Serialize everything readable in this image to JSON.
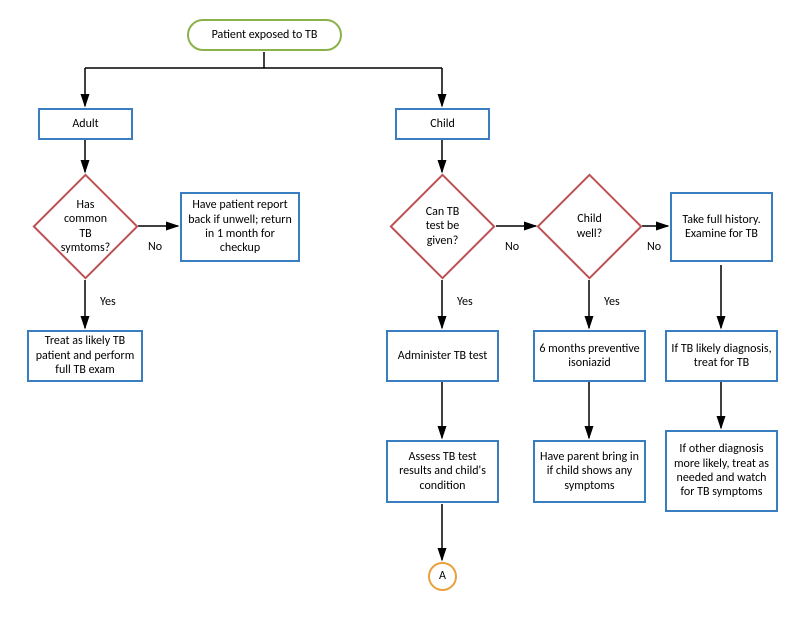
{
  "chart_data": {
    "type": "flowchart",
    "nodes": [
      {
        "id": "start",
        "type": "terminator",
        "text": "Patient exposed to TB"
      },
      {
        "id": "adult",
        "type": "process",
        "text": "Adult"
      },
      {
        "id": "child",
        "type": "process",
        "text": "Child"
      },
      {
        "id": "d_symptoms",
        "type": "decision",
        "text": "Has common TB symtoms?"
      },
      {
        "id": "report_back",
        "type": "process",
        "text": "Have patient report back if unwell; return in 1 month for checkup"
      },
      {
        "id": "full_exam",
        "type": "process",
        "text": "Treat as likely TB patient and perform full TB exam"
      },
      {
        "id": "d_tb_test",
        "type": "decision",
        "text": "Can TB test be given?"
      },
      {
        "id": "d_child_well",
        "type": "decision",
        "text": "Child well?"
      },
      {
        "id": "take_history",
        "type": "process",
        "text": "Take full history. Examine for TB"
      },
      {
        "id": "admin_test",
        "type": "process",
        "text": "Administer TB test"
      },
      {
        "id": "isoniazid",
        "type": "process",
        "text": "6 months preventive isoniazid"
      },
      {
        "id": "treat_tb",
        "type": "process",
        "text": "If TB likely diagnosis, treat for TB"
      },
      {
        "id": "assess_results",
        "type": "process",
        "text": "Assess TB test results and child's condition"
      },
      {
        "id": "parent_bring",
        "type": "process",
        "text": "Have parent bring in if child shows any symptoms"
      },
      {
        "id": "other_diag",
        "type": "process",
        "text": "If other diagnosis more likely, treat as needed and watch for TB symptoms"
      },
      {
        "id": "conn_a",
        "type": "connector",
        "text": "A"
      }
    ],
    "edges": [
      {
        "from": "start",
        "to": "adult"
      },
      {
        "from": "start",
        "to": "child"
      },
      {
        "from": "adult",
        "to": "d_symptoms"
      },
      {
        "from": "d_symptoms",
        "to": "report_back",
        "label": "No"
      },
      {
        "from": "d_symptoms",
        "to": "full_exam",
        "label": "Yes"
      },
      {
        "from": "child",
        "to": "d_tb_test"
      },
      {
        "from": "d_tb_test",
        "to": "admin_test",
        "label": "Yes"
      },
      {
        "from": "d_tb_test",
        "to": "d_child_well",
        "label": "No"
      },
      {
        "from": "d_child_well",
        "to": "isoniazid",
        "label": "Yes"
      },
      {
        "from": "d_child_well",
        "to": "take_history",
        "label": "No"
      },
      {
        "from": "admin_test",
        "to": "assess_results"
      },
      {
        "from": "isoniazid",
        "to": "parent_bring"
      },
      {
        "from": "take_history",
        "to": "treat_tb"
      },
      {
        "from": "treat_tb",
        "to": "other_diag"
      },
      {
        "from": "assess_results",
        "to": "conn_a"
      }
    ]
  },
  "nodes": {
    "start": "Patient exposed to TB",
    "adult": "Adult",
    "child": "Child",
    "symptoms": "Has common TB symtoms?",
    "report_back": "Have patient report back if unwell; return in 1 month for checkup",
    "full_exam": "Treat as likely TB patient and perform full TB exam",
    "tb_test": "Can TB test be given?",
    "child_well": "Child well?",
    "take_history": "Take full history. Examine for TB",
    "admin_test": "Administer TB test",
    "isoniazid": "6 months preventive isoniazid",
    "treat_tb": "If TB likely diagnosis, treat for TB",
    "assess_results": "Assess TB test results and child's condition",
    "parent_bring": "Have parent bring in if child shows any symptoms",
    "other_diag": "If other diagnosis more likely, treat as needed and watch for TB symptoms",
    "conn_a": "A"
  },
  "labels": {
    "yes": "Yes",
    "no": "No"
  }
}
